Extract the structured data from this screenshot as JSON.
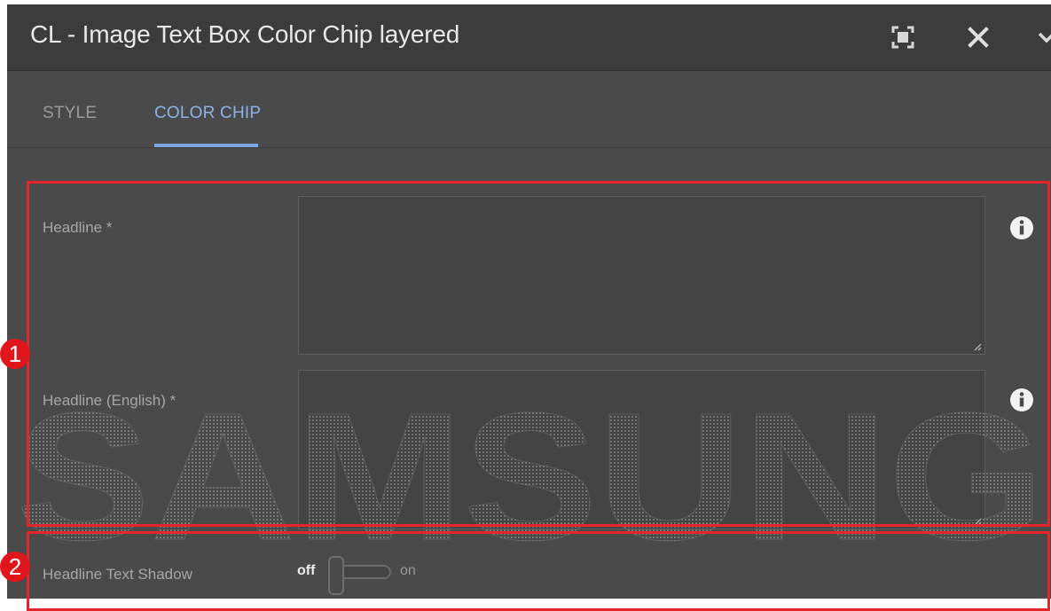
{
  "dialog": {
    "title": "CL - Image Text Box Color Chip layered",
    "controls": {
      "fullscreen_icon": "fullscreen-icon",
      "close_icon": "close-icon",
      "chevron_icon": "chevron-down-icon"
    }
  },
  "tabs": [
    {
      "label": "STYLE",
      "active": false
    },
    {
      "label": "COLOR CHIP",
      "active": true
    }
  ],
  "fields": {
    "headline": {
      "label": "Headline *",
      "value": "",
      "info_icon": "info-icon"
    },
    "headline_english": {
      "label": "Headline (English) *",
      "value": "",
      "info_icon": "info-icon"
    },
    "headline_text_shadow": {
      "label": "Headline Text Shadow",
      "off_label": "off",
      "on_label": "on",
      "state": "off"
    }
  },
  "annotations": {
    "badge_1": "1",
    "badge_2": "2"
  },
  "watermark": {
    "text": "SAMSUNG"
  },
  "colors": {
    "accent": "#7aa7e6",
    "annotation_red": "#e4262b",
    "panel": "#4a4a4a",
    "titlebar": "#3c3c3c"
  }
}
